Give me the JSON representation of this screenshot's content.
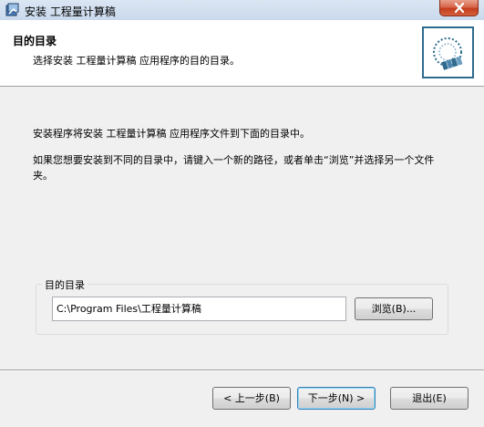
{
  "window": {
    "title": "安装 工程量计算稿",
    "close_icon": "close-icon"
  },
  "header": {
    "title": "目的目录",
    "subtitle": "选择安装 工程量计算稿 应用程序的目的目录。",
    "logo_icon": "install-disc-icon"
  },
  "body": {
    "line1": "安装程序将安装 工程量计算稿 应用程序文件到下面的目录中。",
    "line2": "如果您想要安装到不同的目录中，请键入一个新的路径，或者单击“浏览”并选择另一个文件夹。"
  },
  "destination": {
    "group_label": "目的目录",
    "path_value": "C:\\Program Files\\工程量计算稿",
    "browse_label": "浏览(B)..."
  },
  "buttons": {
    "back_label": "< 上一步(B)",
    "next_label": "下一步(N) >",
    "exit_label": "退出(E)"
  },
  "colors": {
    "title_bar": "#c9d9ec",
    "close_button": "#c43d1c",
    "header_bg": "#ffffff",
    "dialog_bg": "#f0f0f0",
    "default_button_border": "#3c7fb1"
  }
}
